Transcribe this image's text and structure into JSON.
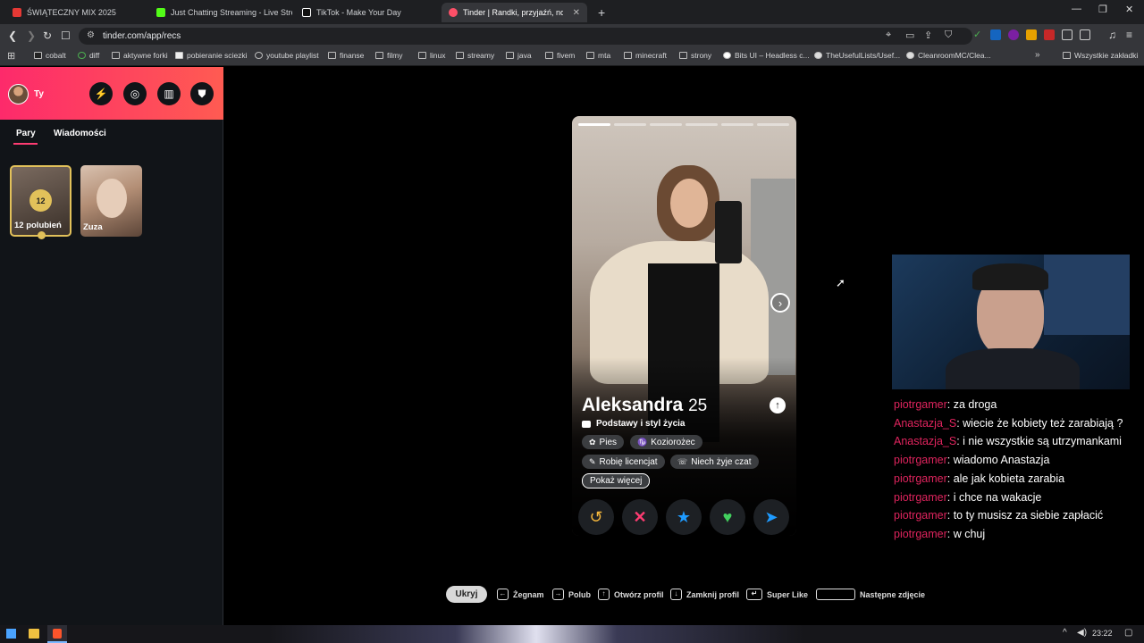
{
  "browser": {
    "tabs": [
      {
        "label": "ŚWIĄTECZNY MIX 2025",
        "color": "#e53935",
        "active": false
      },
      {
        "label": "Just Chatting Streaming - Live Stream",
        "color": "#53fc18",
        "active": false
      },
      {
        "label": "TikTok - Make Your Day",
        "color": "#ffffff",
        "active": false
      },
      {
        "label": "Tinder | Randki, przyjaźń, nowe z",
        "color": "#fd5068",
        "active": true
      }
    ],
    "new_tab": "+",
    "url": "tinder.com/app/recs",
    "bookmarks": [
      {
        "label": "cobalt",
        "icon": "cobalt-icon"
      },
      {
        "label": "diff",
        "icon": "diff-icon"
      },
      {
        "label": "aktywne forki",
        "icon": "fork-icon"
      },
      {
        "label": "pobieranie sciezki",
        "icon": "download-icon"
      },
      {
        "label": "youtube playlist",
        "icon": "globe-icon"
      },
      {
        "label": "finanse",
        "icon": "folder-icon"
      },
      {
        "label": "filmy",
        "icon": "folder-icon"
      },
      {
        "label": "linux",
        "icon": "folder-icon"
      },
      {
        "label": "streamy",
        "icon": "folder-icon"
      },
      {
        "label": "java",
        "icon": "folder-icon"
      },
      {
        "label": "fivem",
        "icon": "folder-icon"
      },
      {
        "label": "mta",
        "icon": "folder-icon"
      },
      {
        "label": "minecraft",
        "icon": "folder-icon"
      },
      {
        "label": "strony",
        "icon": "folder-icon"
      },
      {
        "label": "Bits UI – Headless c...",
        "icon": "circle-icon"
      },
      {
        "label": "TheUsefulLists/Usef...",
        "icon": "github-icon"
      },
      {
        "label": "CleanroomMC/Clea...",
        "icon": "github-icon"
      }
    ],
    "all_bookmarks": "Wszystkie zakładki"
  },
  "sidebar": {
    "user_label": "Ty",
    "tabs": [
      "Pary",
      "Wiadomości"
    ],
    "likes_count": "12",
    "likes_label": "12 polubień",
    "match_name": "Zuza",
    "brand_gradient": [
      "#fd2a6b",
      "#ff5b52"
    ]
  },
  "profile": {
    "name": "Aleksandra",
    "age": "25",
    "section_label": "Podstawy i styl życia",
    "chips": [
      "Pies",
      "Koziorożec",
      "Robię licencjat",
      "Niech żyje czat"
    ],
    "show_more": "Pokaż więcej"
  },
  "chat": [
    {
      "user": "piotrgamer",
      "text": ": za droga",
      "color": "#e0245e"
    },
    {
      "user": "Anastazja_S",
      "text": ": wiecie że kobiety też zarabiają ?",
      "color": "#e0245e"
    },
    {
      "user": "Anastazja_S",
      "text": ": i nie wszystkie są utrzymankami",
      "color": "#e0245e"
    },
    {
      "user": "piotrgamer",
      "text": ": wiadomo Anastazja",
      "color": "#e0245e"
    },
    {
      "user": "piotrgamer",
      "text": ": ale jak kobieta zarabia",
      "color": "#e0245e"
    },
    {
      "user": "piotrgamer",
      "text": ": i chce na wakacje",
      "color": "#e0245e"
    },
    {
      "user": "piotrgamer",
      "text": ": to ty musisz za siebie zapłacić",
      "color": "#e0245e"
    },
    {
      "user": "piotrgamer",
      "text": ": w chuj",
      "color": "#e0245e"
    }
  ],
  "shortcuts": {
    "hide": "Ukryj",
    "items": [
      "Żegnam",
      "Polub",
      "Otwórz profil",
      "Zamknij profil",
      "Super Like",
      "Następne zdjęcie"
    ]
  },
  "taskbar": {
    "time": "23:22"
  }
}
